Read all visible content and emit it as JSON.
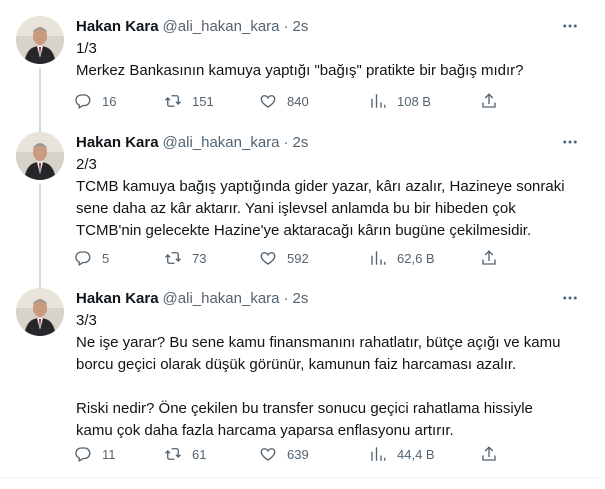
{
  "tweets": [
    {
      "name": "Hakan Kara",
      "handle": "@ali_hakan_kara",
      "time": "2s",
      "text": "1/3\nMerkez Bankasının kamuya yaptığı \"bağış\" pratikte bir bağış mıdır?",
      "replies": "16",
      "retweets": "151",
      "likes": "840",
      "views": "108 B"
    },
    {
      "name": "Hakan Kara",
      "handle": "@ali_hakan_kara",
      "time": "2s",
      "text": "2/3\nTCMB kamuya bağış yaptığında gider yazar, kârı azalır, Hazineye sonraki\nsene daha az kâr aktarır. Yani işlevsel anlamda bu bir hibeden çok\nTCMB'nin gelecekte Hazine'ye aktaracağı kârın bugüne çekilmesidir.",
      "replies": "5",
      "retweets": "73",
      "likes": "592",
      "views": "62,6 B"
    },
    {
      "name": "Hakan Kara",
      "handle": "@ali_hakan_kara",
      "time": "2s",
      "text": "3/3\nNe işe yarar? Bu sene kamu finansmanını rahatlatır, bütçe açığı ve kamu\nborcu geçici olarak düşük görünür, kamunun faiz harcaması azalır.\n\nRiski nedir? Öne çekilen bu transfer sonucu geçici rahatlama hissiyle\nkamu çok daha fazla harcama yaparsa enflasyonu artırır.",
      "replies": "11",
      "retweets": "61",
      "likes": "639",
      "views": "44,4 B"
    }
  ],
  "dot_separator": "·",
  "icons": {
    "reply": "reply-icon",
    "retweet": "retweet-icon",
    "like": "heart-icon",
    "views": "views-icon",
    "share": "share-icon",
    "more": "more-icon"
  },
  "colors": {
    "text": "#0f1419",
    "secondary": "#536471",
    "thread_line": "#cfd9de"
  }
}
